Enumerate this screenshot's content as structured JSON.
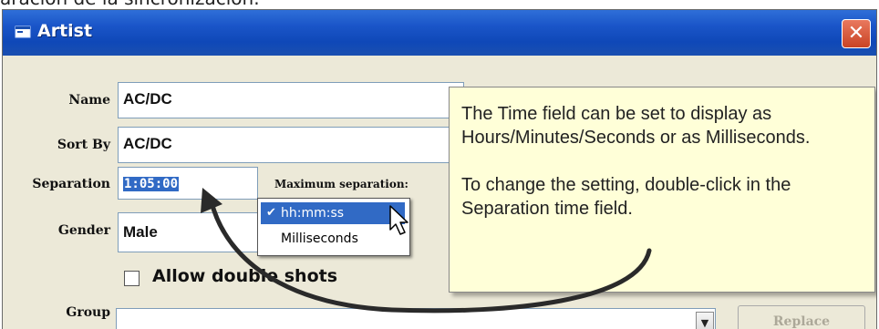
{
  "page_caption": "aración de la sincronización.",
  "window": {
    "title": "Artist",
    "close_glyph": "✕"
  },
  "form": {
    "name_label": "Name",
    "name_value": "AC/DC",
    "sortby_label": "Sort By",
    "sortby_value": "AC/DC",
    "separation_label": "Separation",
    "separation_value": "1:05:00",
    "max_separation_label": "Maximum separation:",
    "gender_label": "Gender",
    "gender_value": "Male",
    "allow_double_shots_label": "Allow double shots",
    "group_label": "Group",
    "group_value": "",
    "replace_label": "Replace"
  },
  "context_menu": {
    "items": [
      {
        "label": "hh:mm:ss",
        "checked": true
      },
      {
        "label": "Milliseconds",
        "checked": false
      }
    ]
  },
  "tooltip": {
    "paragraph1": "The Time field can be set to display as Hours/Minutes/Seconds or as Milliseconds.",
    "paragraph2": "To change the setting, double-click in the Separation time field."
  },
  "colors": {
    "titlebar": "#0f48b8",
    "tooltip_bg": "#ffffd8",
    "selection": "#316ac5",
    "close_button": "#c94324"
  },
  "icons": [
    "window-icon",
    "close-icon",
    "checkmark-icon",
    "dropdown-arrow-icon",
    "mouse-cursor-icon",
    "curved-arrow-icon"
  ]
}
